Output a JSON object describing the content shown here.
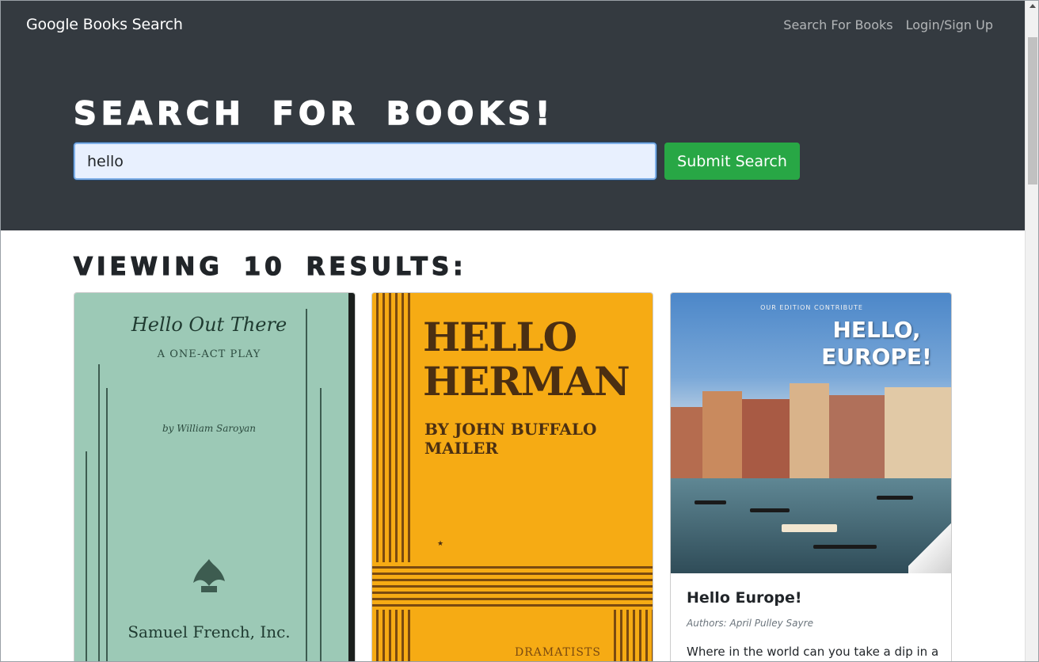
{
  "navbar": {
    "brand": "Google Books Search",
    "links": [
      {
        "label": "Search For Books"
      },
      {
        "label": "Login/Sign Up"
      }
    ]
  },
  "hero": {
    "title": "Search for Books!",
    "search": {
      "value": "hello",
      "placeholder": ""
    },
    "submit_label": "Submit Search"
  },
  "results": {
    "heading": "Viewing 10 results:",
    "cards": [
      {
        "cover": {
          "title": "Hello Out There",
          "subtitle": "A ONE-ACT PLAY",
          "byline": "by William Saroyan",
          "publisher": "Samuel French, Inc."
        }
      },
      {
        "cover": {
          "title_line1": "HELLO",
          "title_line2": "HERMAN",
          "byline": "BY JOHN BUFFALO MAILER",
          "publisher": "DRAMATISTS"
        }
      },
      {
        "cover": {
          "edition": "OUR EDITION CONTRIBUTE",
          "title_line1": "HELLO,",
          "title_line2": "EUROPE!"
        },
        "title": "Hello Europe!",
        "authors": "Authors: April Pulley Sayre",
        "description": "Where in the world can you take a dip in a"
      }
    ]
  },
  "colors": {
    "navbar_bg": "#343a40",
    "submit_bg": "#28a745",
    "input_bg": "#e8f0fe"
  }
}
